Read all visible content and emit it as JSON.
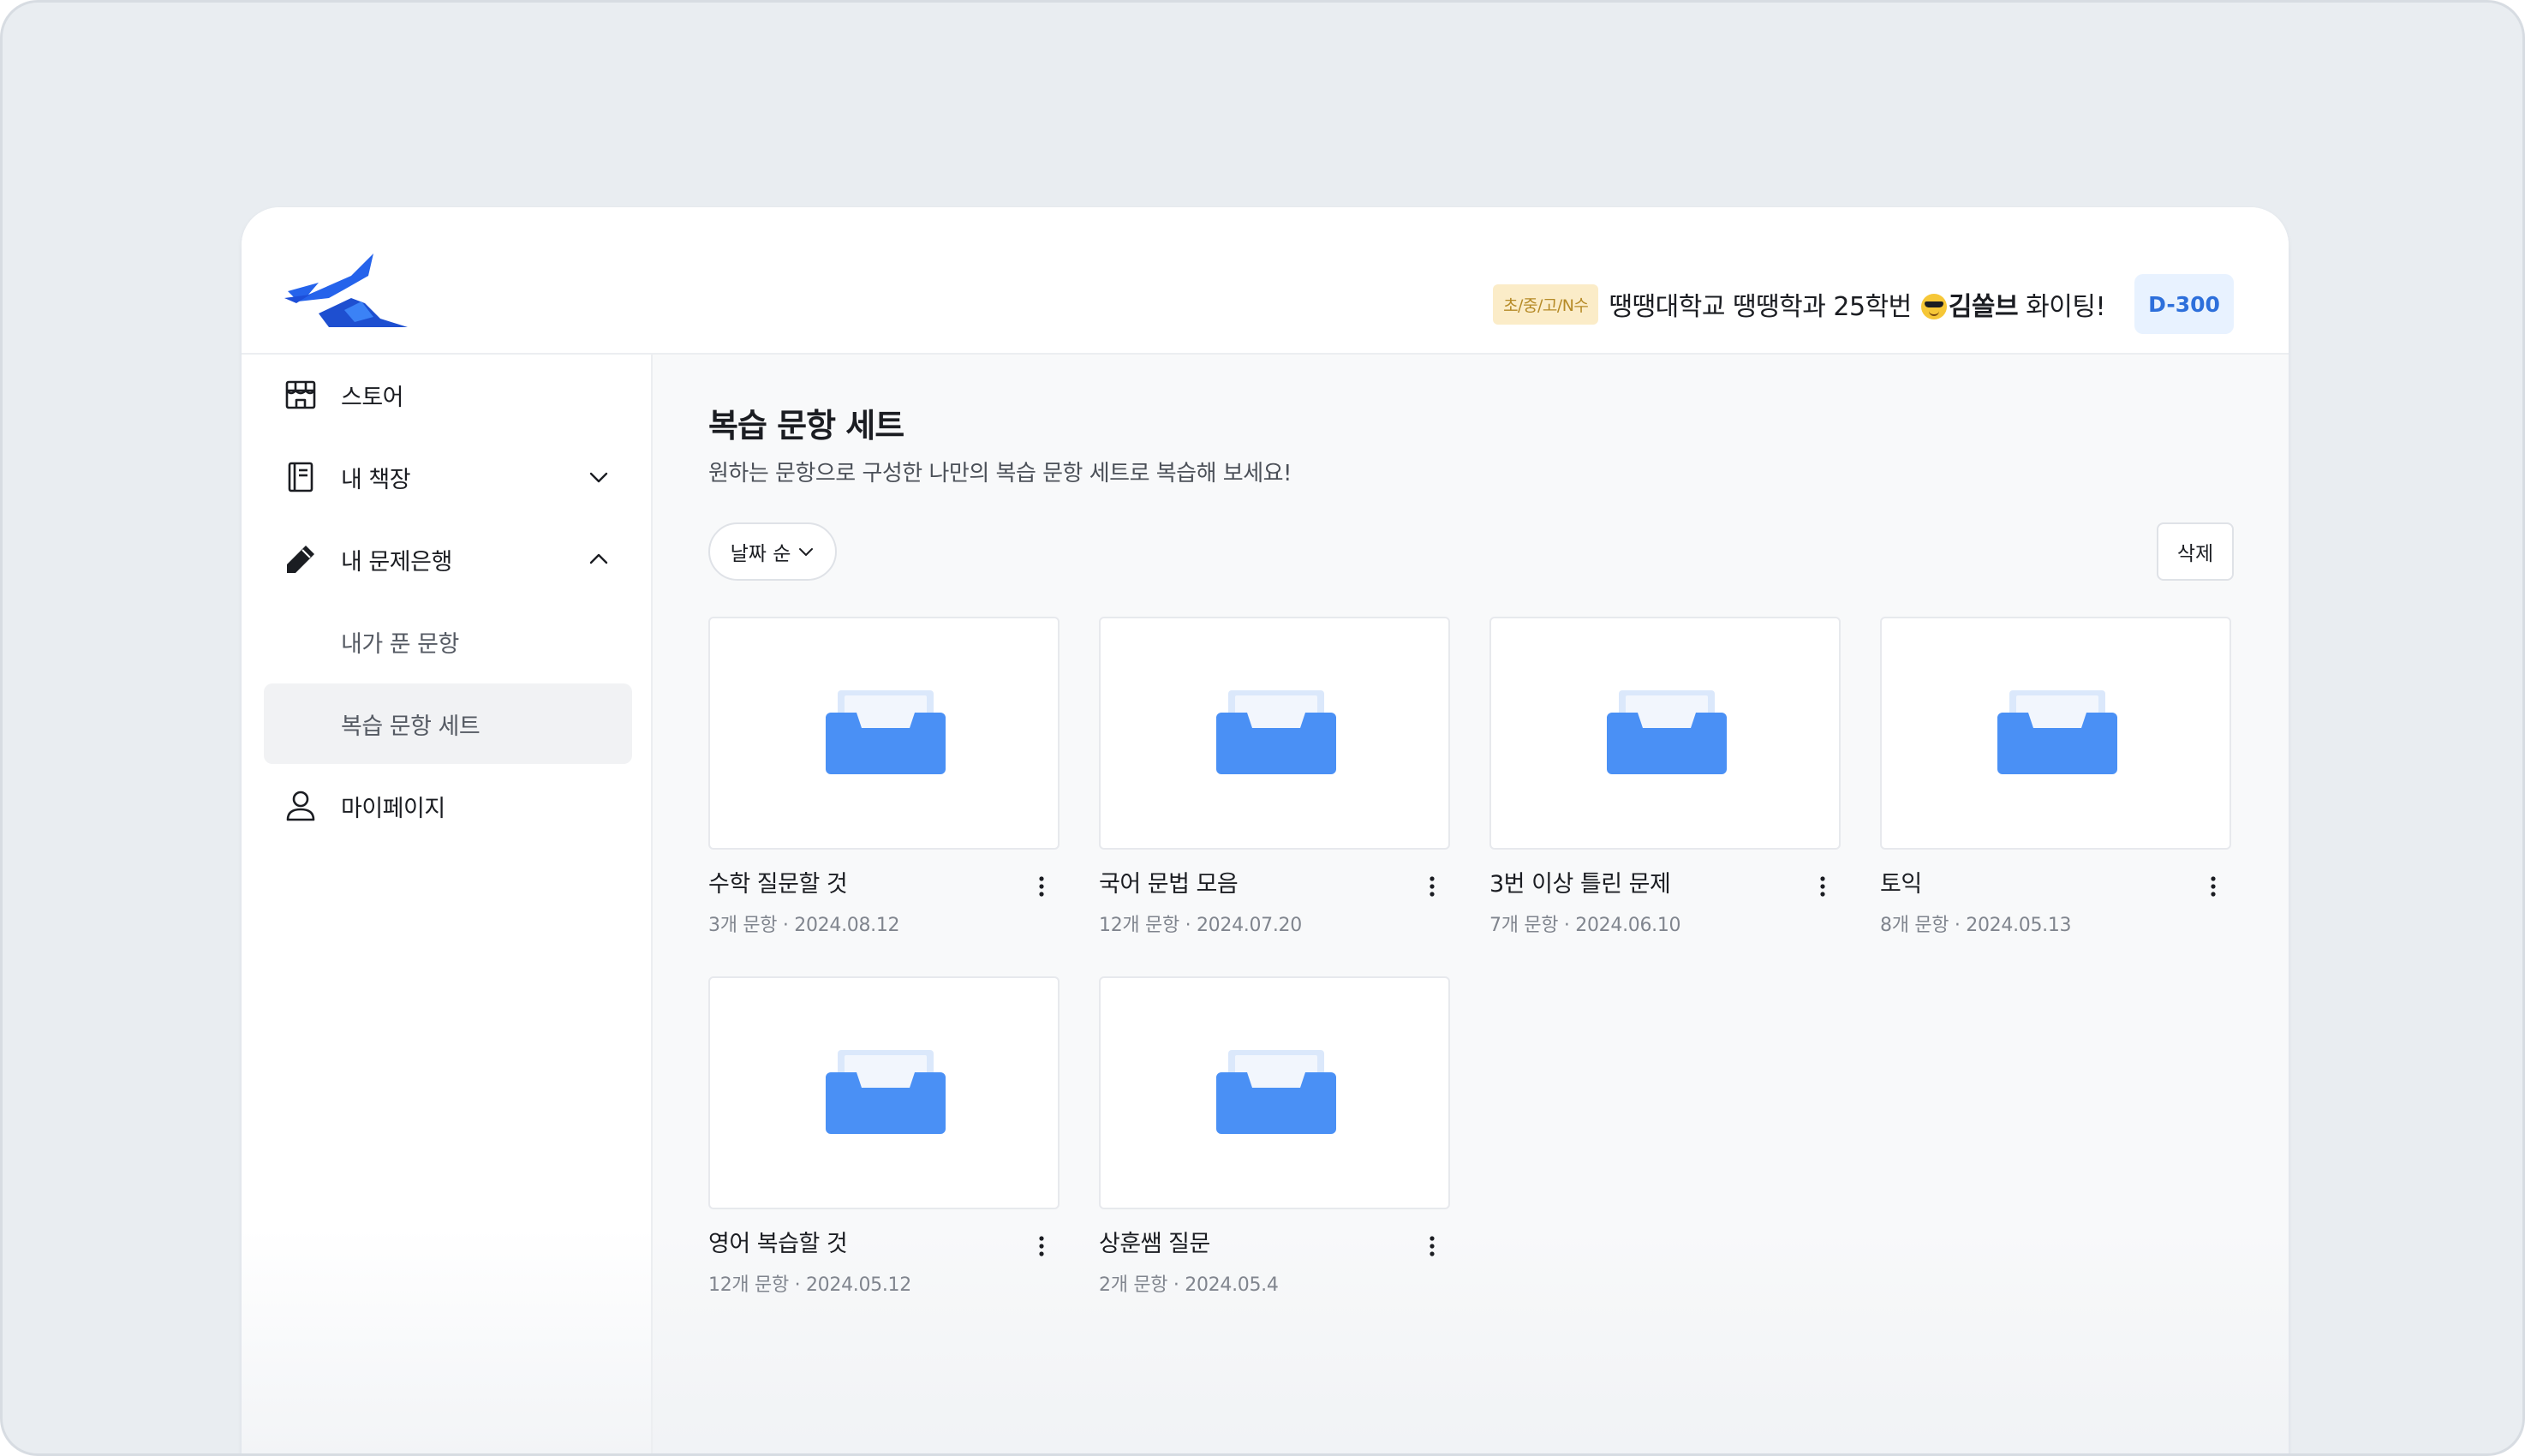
{
  "header": {
    "grade_badge": "초/중/고/N수",
    "goal_prefix": "땡땡대학교 땡땡학과 25학번 ",
    "goal_name": "김쏠브",
    "goal_suffix": " 화이팅!",
    "dday": "D-300"
  },
  "sidebar": {
    "store": "스토어",
    "bookshelf": "내 책장",
    "question_bank": "내 문제은행",
    "solved": "내가 푼 문항",
    "review_sets": "복습 문항 세트",
    "mypage": "마이페이지"
  },
  "main": {
    "title": "복습 문항 세트",
    "subtitle": "원하는 문항으로 구성한 나만의 복습 문항 세트로 복습해 보세요!",
    "sort_label": "날짜 순",
    "delete_label": "삭제",
    "cards": [
      {
        "name": "수학 질문할 것",
        "meta": "3개 문항 · 2024.08.12"
      },
      {
        "name": "국어 문법 모음",
        "meta": "12개 문항 · 2024.07.20"
      },
      {
        "name": "3번 이상 틀린 문제",
        "meta": "7개 문항 · 2024.06.10"
      },
      {
        "name": "토익",
        "meta": "8개 문항 · 2024.05.13"
      },
      {
        "name": "영어 복습할 것",
        "meta": "12개 문항 · 2024.05.12"
      },
      {
        "name": "상훈쌤 질문",
        "meta": "2개 문항 · 2024.05.4"
      }
    ]
  },
  "colors": {
    "accent": "#3b82f6",
    "dday_bg": "#e8f2ff",
    "badge_bg": "#fbecc8"
  },
  "icons": [
    "logo",
    "store-icon",
    "notebook-icon",
    "pencil-icon",
    "user-icon",
    "chevron-down-icon",
    "chevron-up-icon",
    "more-vertical-icon",
    "folder-icon"
  ]
}
